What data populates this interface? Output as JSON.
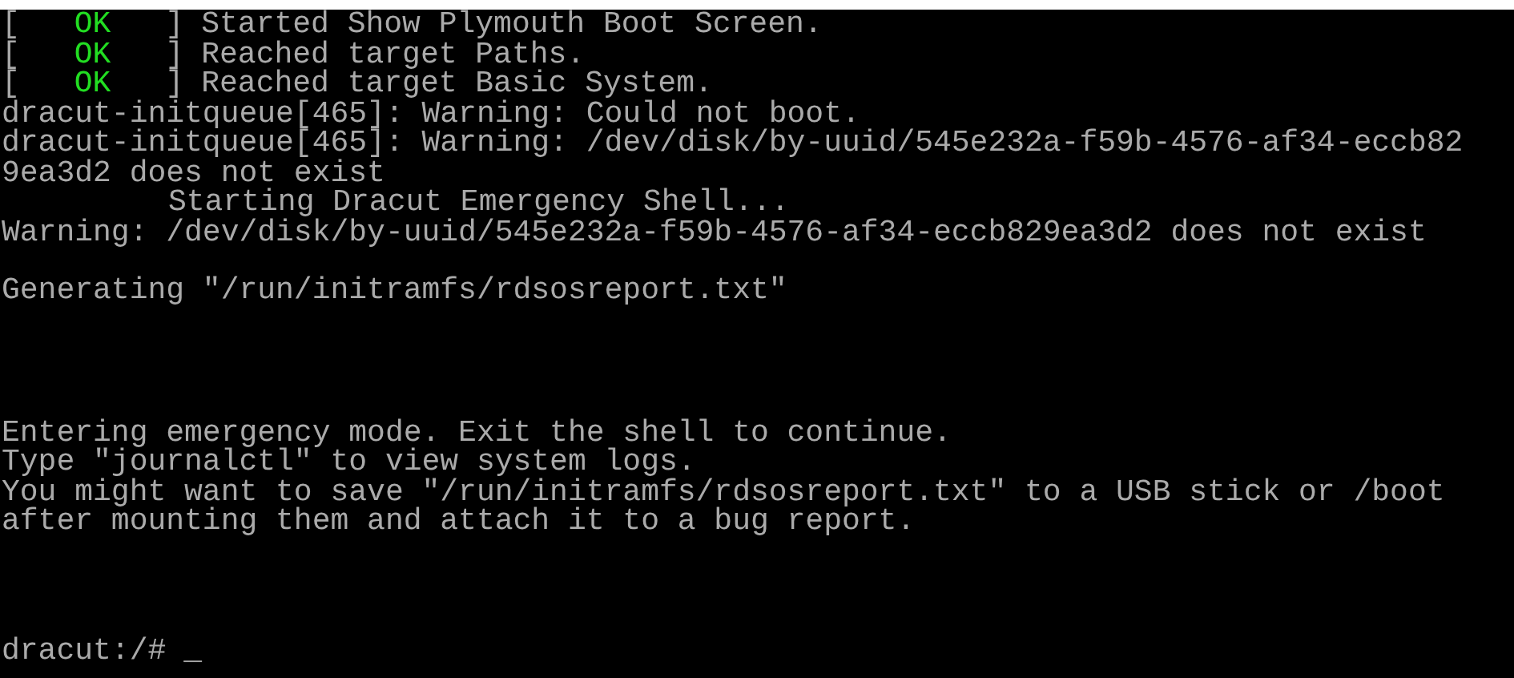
{
  "console": {
    "groups": [
      {
        "lines": [
          {
            "kind": "status",
            "open": "[",
            "status": "OK",
            "close": "]",
            "text": "Started Show Plymouth Boot Screen."
          },
          {
            "kind": "status",
            "open": "[",
            "status": "OK",
            "close": "]",
            "text": "Reached target Paths."
          },
          {
            "kind": "status",
            "open": "[",
            "status": "OK",
            "close": "]",
            "text": "Reached target Basic System."
          },
          {
            "kind": "plain",
            "text": "dracut-initqueue[465]: Warning: Could not boot."
          },
          {
            "kind": "plain",
            "text": "dracut-initqueue[465]: Warning: /dev/disk/by-uuid/545e232a-f59b-4576-af34-eccb82"
          },
          {
            "kind": "plain",
            "text": "9ea3d2 does not exist"
          },
          {
            "kind": "indented",
            "text": "Starting Dracut Emergency Shell..."
          },
          {
            "kind": "plain",
            "text": "Warning: /dev/disk/by-uuid/545e232a-f59b-4576-af34-eccb829ea3d2 does not exist"
          }
        ]
      },
      {
        "lines": [
          {
            "kind": "plain",
            "text": "Generating \"/run/initramfs/rdsosreport.txt\""
          }
        ]
      },
      {
        "lines": [
          {
            "kind": "plain",
            "text": "Entering emergency mode. Exit the shell to continue."
          },
          {
            "kind": "plain",
            "text": "Type \"journalctl\" to view system logs."
          },
          {
            "kind": "plain",
            "text": "You might want to save \"/run/initramfs/rdsosreport.txt\" to a USB stick or /boot"
          },
          {
            "kind": "plain",
            "text": "after mounting them and attach it to a bug report."
          }
        ]
      }
    ],
    "prompt": {
      "text": "dracut:/#",
      "cursor": "_"
    }
  }
}
